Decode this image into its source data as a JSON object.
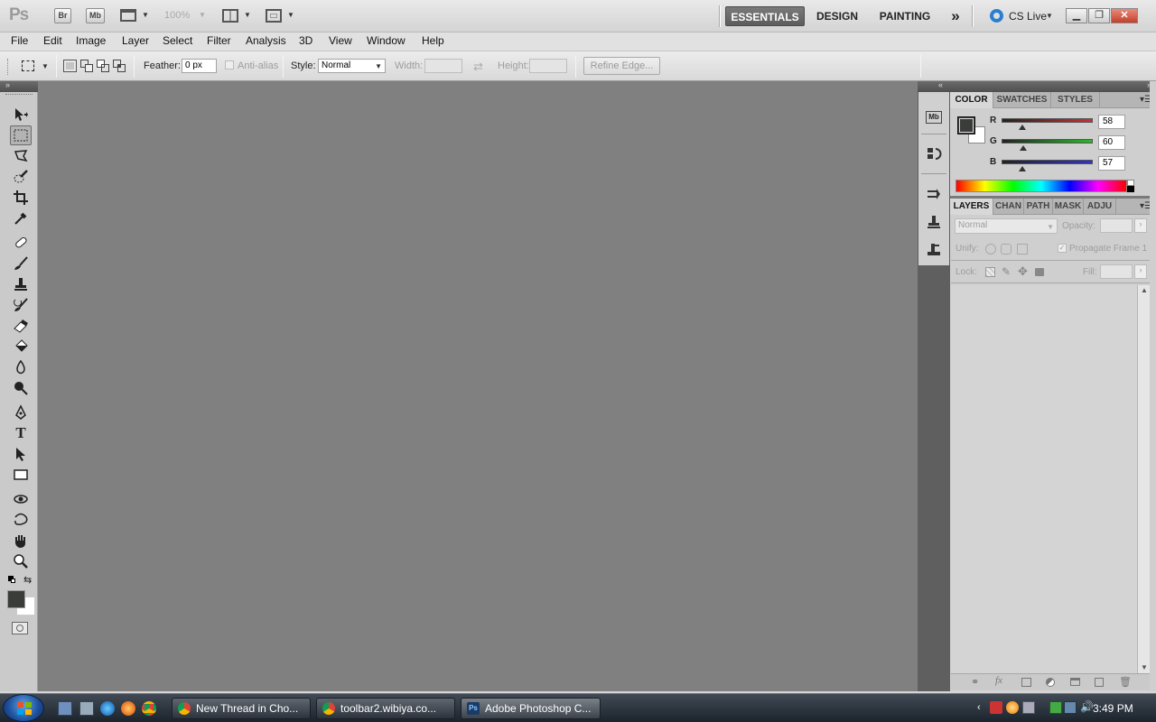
{
  "app": {
    "logo": "Ps",
    "bridge_label": "Br",
    "minibridge_label": "Mb",
    "zoom": "100%",
    "workspaces": [
      "ESSENTIALS",
      "DESIGN",
      "PAINTING"
    ],
    "more_workspaces": "»",
    "cs_live": "CS Live"
  },
  "menu": [
    "File",
    "Edit",
    "Image",
    "Layer",
    "Select",
    "Filter",
    "Analysis",
    "3D",
    "View",
    "Window",
    "Help"
  ],
  "options": {
    "feather_label": "Feather:",
    "feather_value": "0 px",
    "antialias_label": "Anti-alias",
    "style_label": "Style:",
    "style_value": "Normal",
    "width_label": "Width:",
    "height_label": "Height:",
    "refine_edge": "Refine Edge..."
  },
  "color_panel": {
    "tabs": [
      "COLOR",
      "SWATCHES",
      "STYLES"
    ],
    "channels": [
      {
        "label": "R",
        "value": "58",
        "fraction": 0.227,
        "color": "#c83232"
      },
      {
        "label": "G",
        "value": "60",
        "fraction": 0.235,
        "color": "#2db82d"
      },
      {
        "label": "B",
        "value": "57",
        "fraction": 0.224,
        "color": "#3232c8"
      }
    ],
    "foreground": "#3a3c39",
    "background": "#ffffff"
  },
  "layers_panel": {
    "tabs": [
      "LAYERS",
      "CHAN",
      "PATH",
      "MASK",
      "ADJU"
    ],
    "blend_mode": "Normal",
    "opacity_label": "Opacity:",
    "unify_label": "Unify:",
    "propagate_label": "Propagate Frame 1",
    "lock_label": "Lock:",
    "fill_label": "Fill:"
  },
  "taskbar": {
    "tasks": [
      {
        "label": "New Thread in Cho...",
        "icon_color": "#e0b020"
      },
      {
        "label": "toolbar2.wibiya.co...",
        "icon_color": "#e0b020"
      },
      {
        "label": "Adobe Photoshop C...",
        "icon_color": "#1c5aa8"
      }
    ],
    "clock": "3:49 PM"
  }
}
